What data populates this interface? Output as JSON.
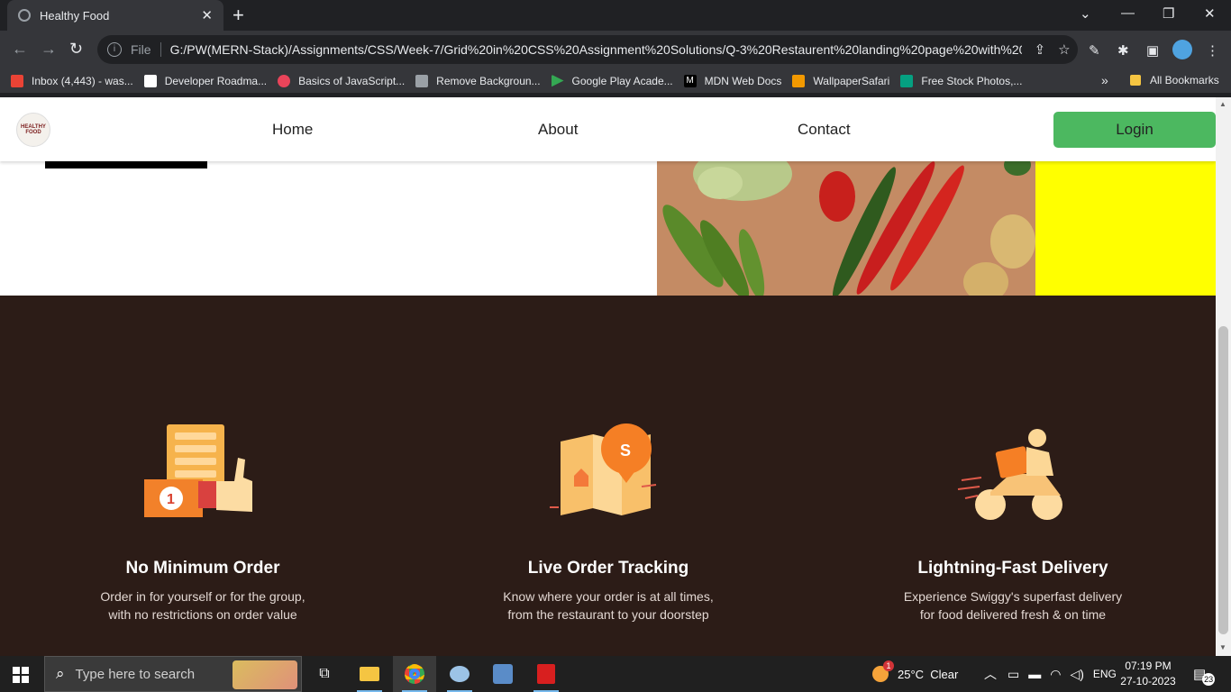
{
  "browser": {
    "tab_title": "Healthy Food",
    "url_scheme_label": "File",
    "url": "G:/PW(MERN-Stack)/Assignments/CSS/Week-7/Grid%20in%20CSS%20Assignment%20Solutions/Q-3%20Restaurent%20landing%20page%20with%20s...",
    "bookmarks": [
      {
        "label": "Inbox (4,443) - was...",
        "color": "#ea4335"
      },
      {
        "label": "Developer Roadma...",
        "color": "#ffffff"
      },
      {
        "label": "Basics of JavaScript...",
        "color": "#e9445a"
      },
      {
        "label": "Remove Backgroun...",
        "color": "#9aa0a6"
      },
      {
        "label": "Google Play Acade...",
        "color": "#34a853"
      },
      {
        "label": "MDN Web Docs",
        "color": "#000000"
      },
      {
        "label": "WallpaperSafari",
        "color": "#f29900"
      },
      {
        "label": "Free Stock Photos,...",
        "color": "#05a081"
      }
    ],
    "all_bookmarks": "All Bookmarks"
  },
  "page": {
    "logo_text": "HEALTHY FOOD",
    "nav": {
      "home": "Home",
      "about": "About",
      "contact": "Contact"
    },
    "login_label": "Login",
    "features": [
      {
        "title": "No Minimum Order",
        "line1": "Order in for yourself or for the group,",
        "line2": "with no restrictions on order value"
      },
      {
        "title": "Live Order Tracking",
        "line1": "Know where your order is at all times,",
        "line2": "from the restaurant to your doorstep"
      },
      {
        "title": "Lightning-Fast Delivery",
        "line1": "Experience Swiggy's superfast delivery",
        "line2": "for food delivered fresh & on time"
      }
    ],
    "colors": {
      "brown": "#2c1c17",
      "login_green": "#4cb860",
      "yellow": "#ffff00"
    }
  },
  "taskbar": {
    "search_placeholder": "Type here to search",
    "weather": "25°C  Clear",
    "weather_badge": "1",
    "language": "ENG",
    "time": "07:19 PM",
    "date": "27-10-2023",
    "notifications": "23"
  }
}
